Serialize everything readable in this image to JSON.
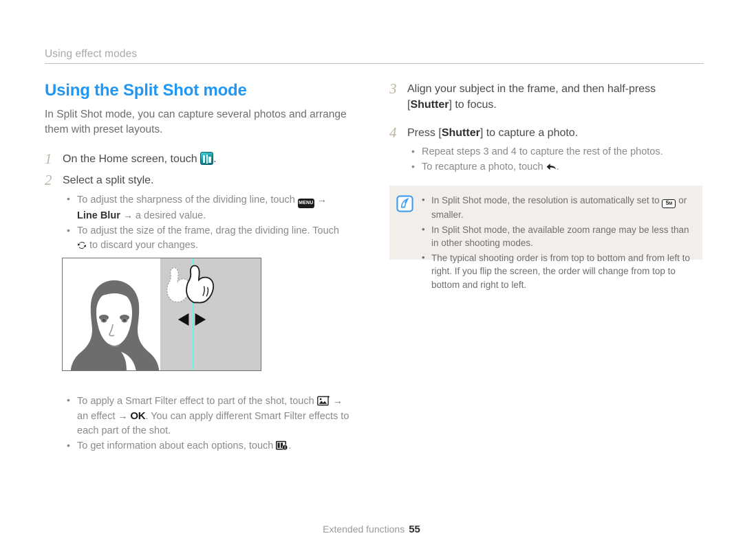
{
  "header": {
    "running_title": "Using effect modes"
  },
  "left_column": {
    "section_title": "Using the Split Shot mode",
    "intro": "In Split Shot mode, you can capture several photos and arrange them with preset layouts.",
    "steps": [
      {
        "number": "1",
        "text_before": "On the Home screen, touch",
        "icon": "split-shot-mode-icon",
        "text_after": "."
      },
      {
        "number": "2",
        "text_before": "Select a split style.",
        "icon": "",
        "text_after": ""
      }
    ],
    "step2_bullets": [
      {
        "part1": "To adjust the sharpness of the dividing line, touch",
        "icon1": "menu-icon",
        "arrow1": "→",
        "bold1": "Line Blur",
        "arrow2": "→",
        "part2": "a desired value."
      },
      {
        "part1": "To adjust the size of the frame, drag the dividing line. Touch",
        "icon1": "refresh-icon",
        "part2": "to discard your changes."
      }
    ],
    "illustration": {
      "name": "split-shot-preview",
      "divider_color": "#6ef0ef",
      "right_panel_color": "#cccccc",
      "gesture": "drag-divider-hand",
      "arrows": "left-right-arrows"
    },
    "lower_bullets": [
      {
        "part1": "To apply a Smart Filter effect to part of the shot, touch",
        "icon1": "smart-filter-icon",
        "arrow1": "→",
        "part2": "an effect",
        "arrow2": "→",
        "ok": "OK",
        "part3": ". You can apply different Smart Filter effects to each part of the shot."
      },
      {
        "part1": "To get information about each options, touch",
        "icon1": "options-info-icon",
        "part2": "."
      }
    ]
  },
  "right_column": {
    "steps": [
      {
        "number": "3",
        "line1": "Align your subject in the frame, and then half-press",
        "bracket_open": "[",
        "bold": "Shutter",
        "bracket_close": "]",
        "line2": "to focus."
      },
      {
        "number": "4",
        "text_before": "Press",
        "bracket_open": "[",
        "bold": "Shutter",
        "bracket_close": "]",
        "text_after": "to capture a photo."
      }
    ],
    "step4_bullets": [
      {
        "text": "Repeat steps 3 and 4 to capture the rest of the photos."
      },
      {
        "part1": "To recapture a photo, touch",
        "icon1": "back-arrow-icon",
        "part2": "."
      }
    ],
    "note_box": {
      "icon": "note-pen-icon",
      "background": "#f2efea",
      "icon_color": "#3d9bf0",
      "items": [
        {
          "part1": "In Split Shot mode, the resolution is automatically set to",
          "icon1": "resolution-5m-icon",
          "icon1_label": "5",
          "icon1_sub": "M",
          "part2": "or smaller."
        },
        {
          "part1": "In Split Shot mode, the available zoom range may be less than in other shooting modes."
        },
        {
          "part1": "The typical shooting order is from top to bottom and from left to right. If you flip the screen, the order will change from top to bottom and right to left."
        }
      ]
    }
  },
  "footer": {
    "label": "Extended functions",
    "page_number": "55"
  }
}
